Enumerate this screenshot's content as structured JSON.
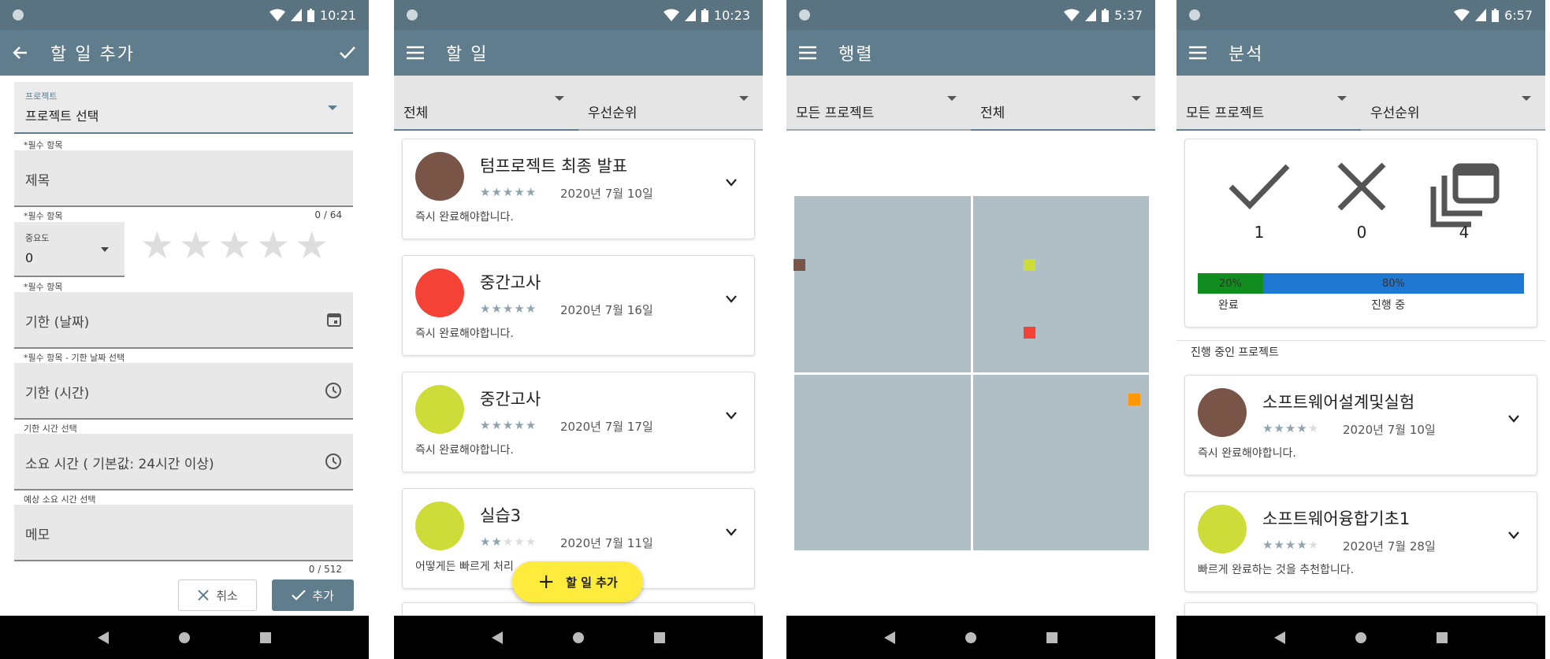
{
  "colors": {
    "statusbar": "#5a7380",
    "appbar": "#5f7d8c",
    "brown": "#795548",
    "red": "#f44336",
    "lime": "#cddc39",
    "orange": "#ff9800",
    "done": "#118c1e",
    "progress": "#1e78d2",
    "star_on": "#90a4ae",
    "star_off": "#dddddd",
    "fab": "#ffeb3b"
  },
  "screen1": {
    "time": "10:21",
    "title": "할 일 추가",
    "project_label": "프로젝트",
    "project_value": "프로젝트 선택",
    "project_helper": "*필수 항목",
    "title_field": "제목",
    "title_helper": "*필수 항목",
    "title_counter": "0 / 64",
    "importance_label": "중요도",
    "importance_value": "0",
    "importance_helper": "*필수 항목",
    "deadline_date": "기한 (날짜)",
    "deadline_date_helper": "*필수 항목 - 기한 날짜 선택",
    "deadline_time": "기한 (시간)",
    "deadline_time_helper": "기한 시간 선택",
    "duration": "소요 시간 ( 기본값: 24시간 이상)",
    "duration_helper": "예상 소요 시간 선택",
    "memo": "메모",
    "memo_counter": "0 / 512",
    "cancel": "취소",
    "add": "추가",
    "star": "★"
  },
  "screen2": {
    "time": "10:23",
    "title": "할 일",
    "filter1": "전체",
    "filter2": "우선순위",
    "tasks": [
      {
        "title": "텀프로젝트 최종 발표",
        "date": "2020년 7월 10일",
        "note": "즉시 완료해야합니다.",
        "color": "brown",
        "stars": 5
      },
      {
        "title": "중간고사",
        "date": "2020년 7월 16일",
        "note": "즉시 완료해야합니다.",
        "color": "red",
        "stars": 5
      },
      {
        "title": "중간고사",
        "date": "2020년 7월 17일",
        "note": "즉시 완료해야합니다.",
        "color": "lime",
        "stars": 5
      },
      {
        "title": "실습3",
        "date": "2020년 7월 11일",
        "note": "어떻게든 빠르게 처리",
        "color": "lime",
        "stars": 2
      }
    ],
    "fab_label": "할 일 추가",
    "fab_plus": "+"
  },
  "screen3": {
    "time": "5:37",
    "title": "행렬",
    "filter1": "모든 프로젝트",
    "filter2": "전체"
  },
  "screen4": {
    "time": "6:57",
    "title": "분석",
    "filter1": "모든 프로젝트",
    "filter2": "우선순위",
    "done_count": "1",
    "failed_count": "0",
    "total_count": "4",
    "done_pct": "20%",
    "progress_pct": "80%",
    "done_fraction": 0.2,
    "done_label": "완료",
    "progress_label": "진행 중",
    "section": "진행 중인 프로젝트",
    "projects": [
      {
        "title": "소프트웨어설계및실험",
        "date": "2020년 7월 10일",
        "note": "즉시 완료해야합니다.",
        "color": "brown",
        "stars": 4
      },
      {
        "title": "소프트웨어융합기초1",
        "date": "2020년 7월 28일",
        "note": "빠르게 완료하는 것을 추천합니다.",
        "color": "lime",
        "stars": 4
      }
    ]
  }
}
